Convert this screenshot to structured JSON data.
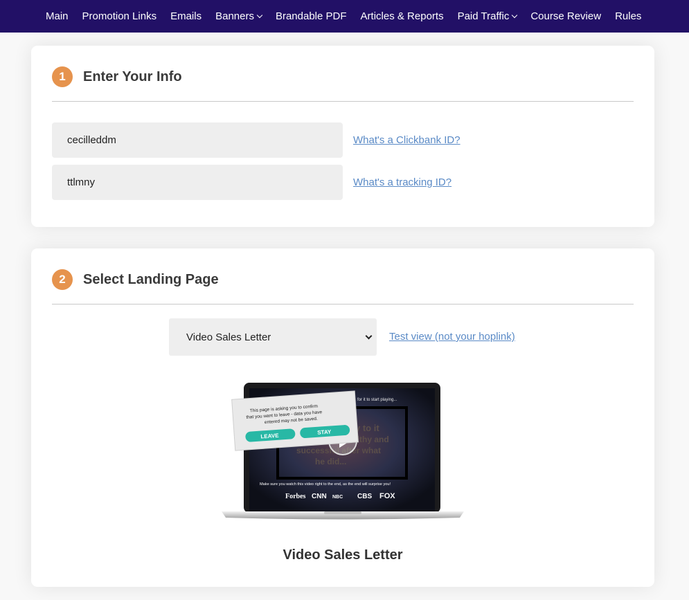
{
  "nav": {
    "items": [
      {
        "label": "Main",
        "dropdown": false
      },
      {
        "label": "Promotion Links",
        "dropdown": false
      },
      {
        "label": "Emails",
        "dropdown": false
      },
      {
        "label": "Banners",
        "dropdown": true
      },
      {
        "label": "Brandable PDF",
        "dropdown": false
      },
      {
        "label": "Articles & Reports",
        "dropdown": false
      },
      {
        "label": "Paid Traffic",
        "dropdown": true
      },
      {
        "label": "Course Review",
        "dropdown": false
      },
      {
        "label": "Rules",
        "dropdown": false
      }
    ]
  },
  "section1": {
    "step": "1",
    "title": "Enter Your Info",
    "clickbank_value": "cecilleddm",
    "clickbank_help": "What's a Clickbank ID?",
    "tracking_value": "ttlmny",
    "tracking_help": "What's a tracking ID?"
  },
  "section2": {
    "step": "2",
    "title": "Select Landing Page",
    "selected_option": "Video Sales Letter",
    "test_link": "Test view (not your hoplink)",
    "preview": {
      "popup_text": [
        "This page is asking you to confirm",
        "that you want to  leave - data you have",
        "entered may not be saved."
      ],
      "leave_label": "LEAVE",
      "stay_label": "STAY",
      "top_text": "for it to start playing...",
      "headline_lines": [
        "y to it",
        "healthy and",
        "successful   after what",
        "he did..."
      ],
      "bottom_text": "Make sure you watch this video right to the end, as the end will surprise you!",
      "logos": [
        "Forbes",
        "CNN",
        "NBC",
        "CBS",
        "FOX"
      ]
    },
    "caption": "Video Sales Letter"
  },
  "colors": {
    "nav_bg": "#221066",
    "step_badge": "#e6934d",
    "link": "#5a8ac6",
    "button_teal": "#28b8a5"
  }
}
